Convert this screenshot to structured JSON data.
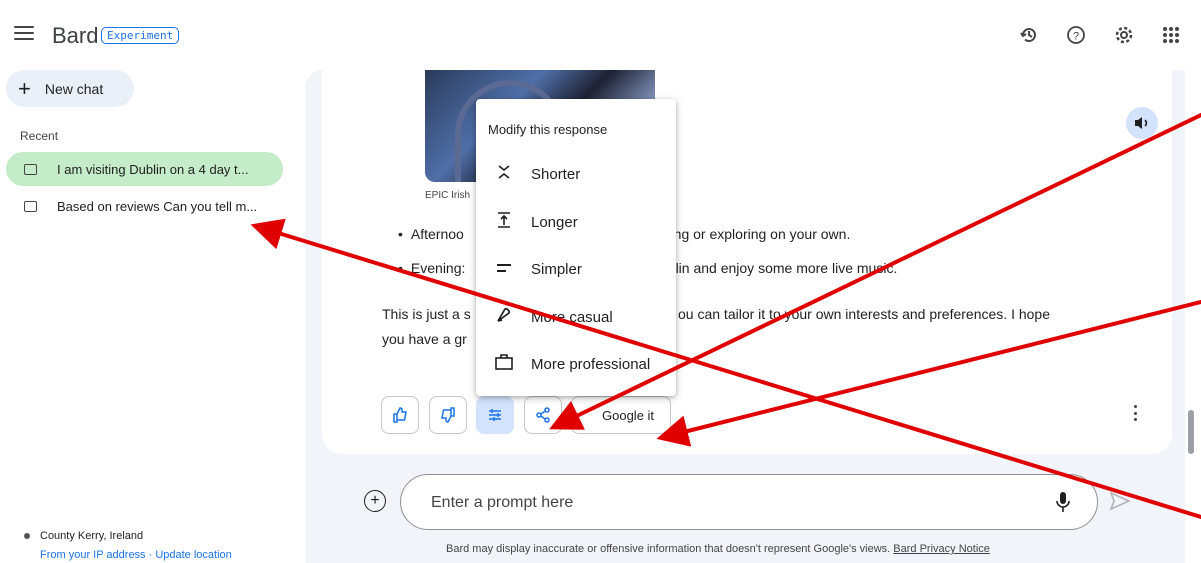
{
  "header": {
    "menu_icon": "hamburger-icon",
    "brand": "Bard",
    "badge": "Experiment",
    "icons": [
      "history-icon",
      "help-icon",
      "gear-icon",
      "apps-grid-icon"
    ]
  },
  "sidebar": {
    "new_chat": "New chat",
    "recent_label": "Recent",
    "items": [
      {
        "label": "I am visiting Dublin on a 4 day t...",
        "active": true
      },
      {
        "label": "Based on reviews Can you tell m...",
        "active": false
      }
    ],
    "location": "County Kerry, Ireland",
    "location_links": "From your IP address · Update location"
  },
  "response": {
    "image_caption": "EPIC Irish",
    "bullets": [
      "Afternoo",
      "Evening:"
    ],
    "bullets_tail": [
      "pping or exploring on your own.",
      "ublin and enjoy some more live music."
    ],
    "para_line1_start": "This is just a s",
    "para_line1_end": "ou can tailor it to your own interests and preferences. I hope",
    "para_line2": "you have a gr"
  },
  "menu": {
    "title": "Modify this response",
    "items": [
      {
        "label": "Shorter",
        "icon": "shorter-icon",
        "glyph": "⌄"
      },
      {
        "label": "Longer",
        "icon": "longer-icon",
        "glyph": "⭱"
      },
      {
        "label": "Simpler",
        "icon": "simpler-icon",
        "glyph": "="
      },
      {
        "label": "More casual",
        "icon": "casual-icon",
        "glyph": "✎"
      },
      {
        "label": "More professional",
        "icon": "briefcase-icon",
        "glyph": "▢"
      }
    ]
  },
  "actions": {
    "google_it": "Google it",
    "icons": [
      "thumbs-up-icon",
      "thumbs-down-icon",
      "modify-response-icon",
      "share-icon",
      "more-options-icon"
    ]
  },
  "prompt": {
    "placeholder": "Enter a prompt here",
    "disclaimer": "Bard may display inaccurate or offensive information that doesn't represent Google's views.",
    "privacy_link": "Bard Privacy Notice"
  },
  "colors": {
    "accent": "#1a73e8",
    "active_chat": "#c5ecc8",
    "annotation_arrow": "#e00000"
  }
}
